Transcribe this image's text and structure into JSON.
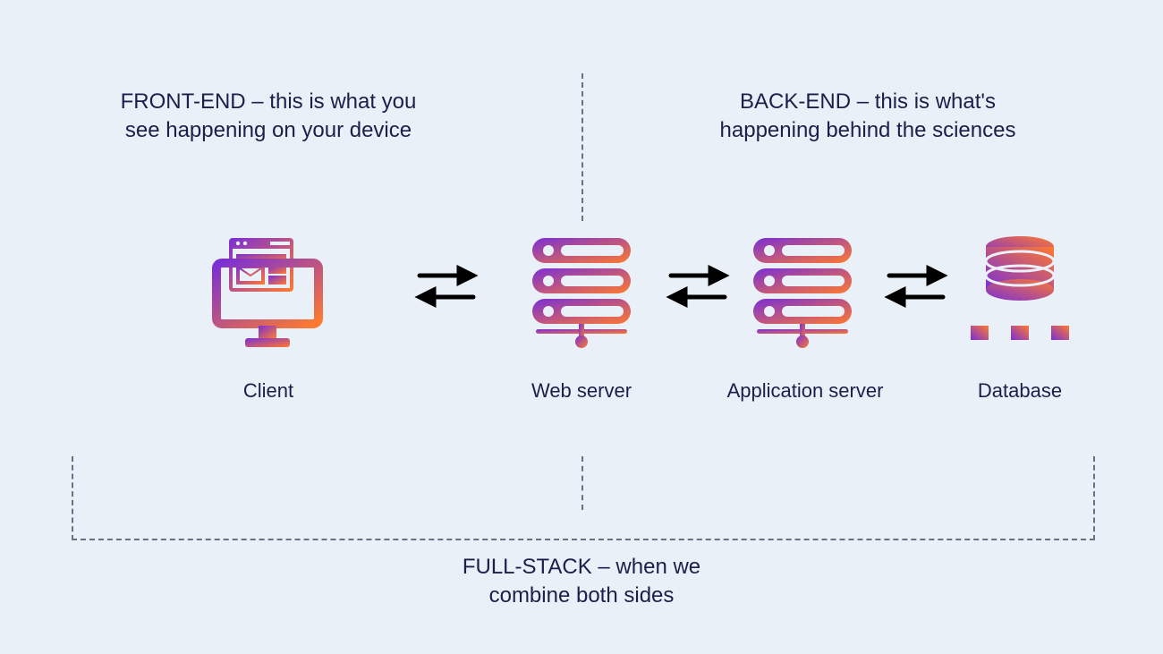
{
  "captions": {
    "frontend": "FRONT-END – this is what you see happening on your device",
    "backend": "BACK-END – this is what's happening behind the sciences",
    "fullstack": "FULL-STACK – when we combine both sides"
  },
  "nodes": {
    "client": "Client",
    "web_server": "Web server",
    "app_server": "Application server",
    "database": "Database"
  },
  "icons": {
    "client": "client-computer-icon",
    "web_server": "server-rack-icon",
    "app_server": "server-rack-icon",
    "database": "database-icon",
    "arrows": "double-arrow-icon"
  },
  "colors": {
    "bg": "#eaf0f8",
    "text": "#1b1f4a",
    "dash": "#6b6f86",
    "grad_from": "#7a2fd6",
    "grad_to": "#ff7a2f",
    "arrow": "#000000"
  }
}
